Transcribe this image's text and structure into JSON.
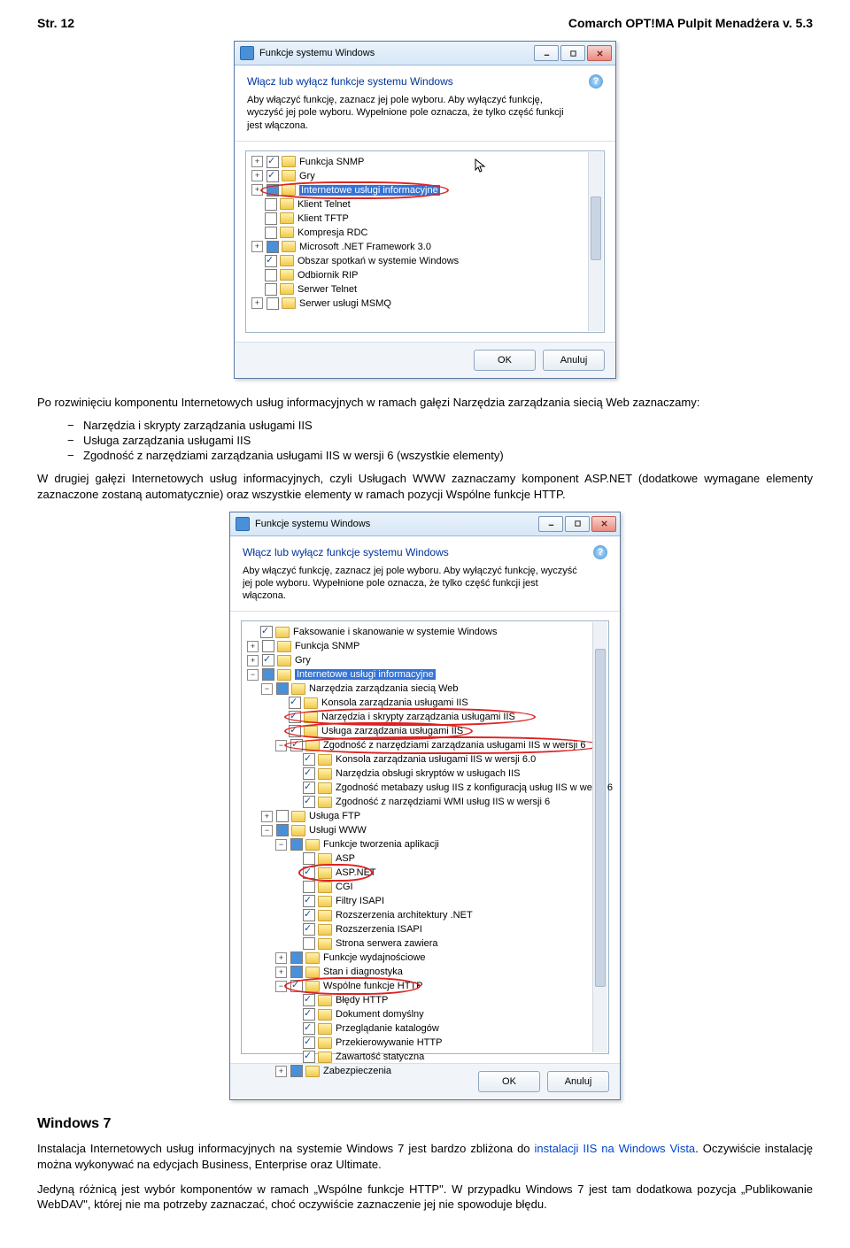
{
  "header": {
    "left": "Str. 12",
    "right": "Comarch OPT!MA Pulpit Menadżera v. 5.3"
  },
  "dialog1": {
    "title": "Funkcje systemu Windows",
    "heading": "Włącz lub wyłącz funkcje systemu Windows",
    "desc": "Aby włączyć funkcję, zaznacz jej pole wyboru. Aby wyłączyć funkcję, wyczyść jej pole wyboru. Wypełnione pole oznacza, że tylko część funkcji jest włączona.",
    "items": [
      {
        "exp": "+",
        "chk": "on",
        "label": "Funkcja SNMP"
      },
      {
        "exp": "+",
        "chk": "on",
        "label": "Gry"
      },
      {
        "exp": "+",
        "chk": "half",
        "label": "Internetowe usługi informacyjne",
        "sel": true,
        "circ": true
      },
      {
        "exp": " ",
        "chk": "",
        "label": "Klient Telnet"
      },
      {
        "exp": " ",
        "chk": "",
        "label": "Klient TFTP"
      },
      {
        "exp": " ",
        "chk": "",
        "label": "Kompresja RDC"
      },
      {
        "exp": "+",
        "chk": "half",
        "label": "Microsoft .NET Framework 3.0"
      },
      {
        "exp": " ",
        "chk": "on",
        "label": "Obszar spotkań w systemie Windows"
      },
      {
        "exp": " ",
        "chk": "",
        "label": "Odbiornik RIP"
      },
      {
        "exp": " ",
        "chk": "",
        "label": "Serwer Telnet"
      },
      {
        "exp": "+",
        "chk": "",
        "label": "Serwer usługi MSMQ"
      }
    ],
    "ok": "OK",
    "cancel": "Anuluj"
  },
  "para1_intro": "Po rozwinięciu komponentu Internetowych usług informacyjnych w ramach gałęzi Narzędzia zarządzania siecią Web zaznaczamy:",
  "bullets": [
    "Narzędzia i skrypty zarządzania usługami IIS",
    "Usługa zarządzania usługami IIS",
    "Zgodność z narzędziami zarządzania usługami IIS w wersji 6 (wszystkie elementy)"
  ],
  "para2": "W drugiej gałęzi Internetowych usług informacyjnych, czyli Usługach WWW zaznaczamy komponent ASP.NET (dodatkowe wymagane elementy zaznaczone zostaną automatycznie) oraz wszystkie elementy w ramach pozycji Wspólne funkcje HTTP.",
  "dialog2": {
    "title": "Funkcje systemu Windows",
    "heading": "Włącz lub wyłącz funkcje systemu Windows",
    "desc": "Aby włączyć funkcję, zaznacz jej pole wyboru. Aby wyłączyć funkcję, wyczyść jej pole wyboru. Wypełnione pole oznacza, że tylko część funkcji jest włączona.",
    "items": [
      {
        "ind": 0,
        "exp": " ",
        "chk": "on",
        "label": "Faksowanie i skanowanie w systemie Windows"
      },
      {
        "ind": 0,
        "exp": "+",
        "chk": "",
        "label": "Funkcja SNMP"
      },
      {
        "ind": 0,
        "exp": "+",
        "chk": "on",
        "label": "Gry"
      },
      {
        "ind": 0,
        "exp": "−",
        "chk": "half",
        "label": "Internetowe usługi informacyjne",
        "sel": true
      },
      {
        "ind": 1,
        "exp": "−",
        "chk": "half",
        "label": "Narzędzia zarządzania siecią Web"
      },
      {
        "ind": 2,
        "exp": " ",
        "chk": "on",
        "label": "Konsola zarządzania usługami IIS"
      },
      {
        "ind": 2,
        "exp": " ",
        "chk": "on",
        "label": "Narzędzia i skrypty zarządzania usługami IIS",
        "circ": true
      },
      {
        "ind": 2,
        "exp": " ",
        "chk": "on",
        "label": "Usługa zarządzania usługami IIS",
        "circ": true
      },
      {
        "ind": 2,
        "exp": "−",
        "chk": "on",
        "label": "Zgodność z narzędziami zarządzania usługami IIS w wersji 6",
        "circ": true
      },
      {
        "ind": 3,
        "exp": " ",
        "chk": "on",
        "label": "Konsola zarządzania usługami IIS w wersji 6.0"
      },
      {
        "ind": 3,
        "exp": " ",
        "chk": "on",
        "label": "Narzędzia obsługi skryptów w usługach IIS"
      },
      {
        "ind": 3,
        "exp": " ",
        "chk": "on",
        "label": "Zgodność metabazy usług IIS z konfiguracją usług IIS w wersji 6"
      },
      {
        "ind": 3,
        "exp": " ",
        "chk": "on",
        "label": "Zgodność z narzędziami WMI usług IIS w wersji 6"
      },
      {
        "ind": 1,
        "exp": "+",
        "chk": "",
        "label": "Usługa FTP"
      },
      {
        "ind": 1,
        "exp": "−",
        "chk": "half",
        "label": "Usługi WWW"
      },
      {
        "ind": 2,
        "exp": "−",
        "chk": "half",
        "label": "Funkcje tworzenia aplikacji"
      },
      {
        "ind": 3,
        "exp": " ",
        "chk": "",
        "label": "ASP"
      },
      {
        "ind": 3,
        "exp": " ",
        "chk": "on",
        "label": "ASP.NET",
        "circ": true
      },
      {
        "ind": 3,
        "exp": " ",
        "chk": "",
        "label": "CGI"
      },
      {
        "ind": 3,
        "exp": " ",
        "chk": "on",
        "label": "Filtry ISAPI"
      },
      {
        "ind": 3,
        "exp": " ",
        "chk": "on",
        "label": "Rozszerzenia architektury .NET"
      },
      {
        "ind": 3,
        "exp": " ",
        "chk": "on",
        "label": "Rozszerzenia ISAPI"
      },
      {
        "ind": 3,
        "exp": " ",
        "chk": "",
        "label": "Strona serwera zawiera"
      },
      {
        "ind": 2,
        "exp": "+",
        "chk": "half",
        "label": "Funkcje wydajnościowe"
      },
      {
        "ind": 2,
        "exp": "+",
        "chk": "half",
        "label": "Stan i diagnostyka"
      },
      {
        "ind": 2,
        "exp": "−",
        "chk": "on",
        "label": "Wspólne funkcje HTTP",
        "circ": true
      },
      {
        "ind": 3,
        "exp": " ",
        "chk": "on",
        "label": "Błędy HTTP"
      },
      {
        "ind": 3,
        "exp": " ",
        "chk": "on",
        "label": "Dokument domyślny"
      },
      {
        "ind": 3,
        "exp": " ",
        "chk": "on",
        "label": "Przeglądanie katalogów"
      },
      {
        "ind": 3,
        "exp": " ",
        "chk": "on",
        "label": "Przekierowywanie HTTP"
      },
      {
        "ind": 3,
        "exp": " ",
        "chk": "on",
        "label": "Zawartość statyczna"
      },
      {
        "ind": 2,
        "exp": "+",
        "chk": "half",
        "label": "Zabezpieczenia"
      }
    ],
    "ok": "OK",
    "cancel": "Anuluj"
  },
  "win7": {
    "title": "Windows 7",
    "p1a": "Instalacja Internetowych usług informacyjnych na systemie Windows 7 jest bardzo zbliżona do ",
    "link": "instalacji IIS na Windows Vista",
    "p1b": ". Oczywiście instalację można wykonywać na edycjach Business, Enterprise oraz Ultimate.",
    "p2": "Jedyną różnicą jest wybór komponentów w ramach „Wspólne funkcje HTTP\". W przypadku Windows 7 jest tam dodatkowa pozycja „Publikowanie WebDAV\", której nie ma potrzeby zaznaczać, choć oczywiście zaznaczenie jej nie spowoduje błędu."
  }
}
